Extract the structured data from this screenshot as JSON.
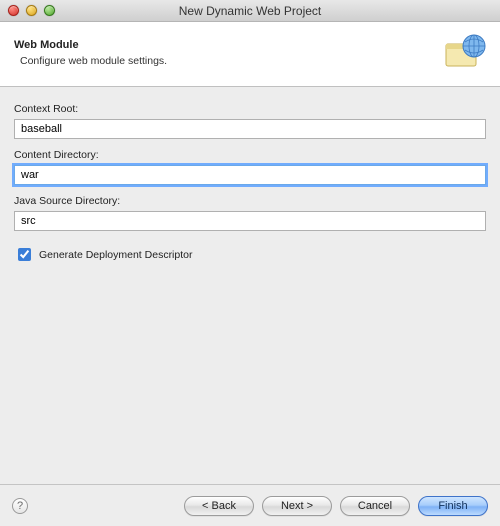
{
  "window": {
    "title": "New Dynamic Web Project"
  },
  "banner": {
    "title": "Web Module",
    "subtitle": "Configure web module settings."
  },
  "fields": {
    "context_root": {
      "label": "Context Root:",
      "value": "baseball"
    },
    "content_dir": {
      "label": "Content Directory:",
      "value": "war"
    },
    "java_src": {
      "label": "Java Source Directory:",
      "value": "src"
    }
  },
  "checkbox": {
    "label": "Generate Deployment Descriptor",
    "checked": true
  },
  "buttons": {
    "back": "< Back",
    "next": "Next >",
    "cancel": "Cancel",
    "finish": "Finish"
  },
  "help_glyph": "?"
}
